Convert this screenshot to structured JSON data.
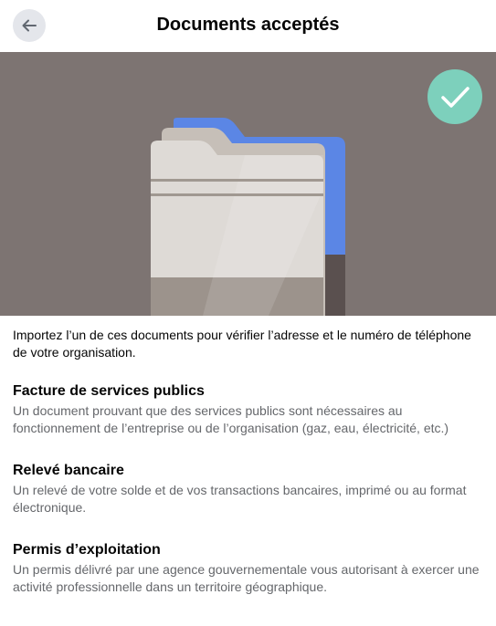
{
  "header": {
    "title": "Documents acceptés",
    "back_icon": "arrow-left-icon"
  },
  "hero": {
    "illustration": "folder-icon",
    "status_icon": "checkmark-icon",
    "colors": {
      "background": "#7d7472",
      "check_badge": "#7dd0bc",
      "folder_tab": "#5b86e5"
    }
  },
  "intro": "Importez l’un de ces documents pour vérifier l’adresse et le numéro de téléphone de votre organisation.",
  "documents": [
    {
      "title": "Facture de services publics",
      "description": "Un document prouvant que des services publics sont nécessaires au fonctionnement de l’entreprise ou de l’organisation (gaz, eau, électricité, etc.)"
    },
    {
      "title": "Relevé bancaire",
      "description": "Un relevé de votre solde et de vos transactions bancaires, imprimé ou au format électronique."
    },
    {
      "title": "Permis d’exploitation",
      "description": "Un permis délivré par une agence gouvernementale vous autorisant à exercer une activité professionnelle dans un territoire géographique."
    }
  ]
}
